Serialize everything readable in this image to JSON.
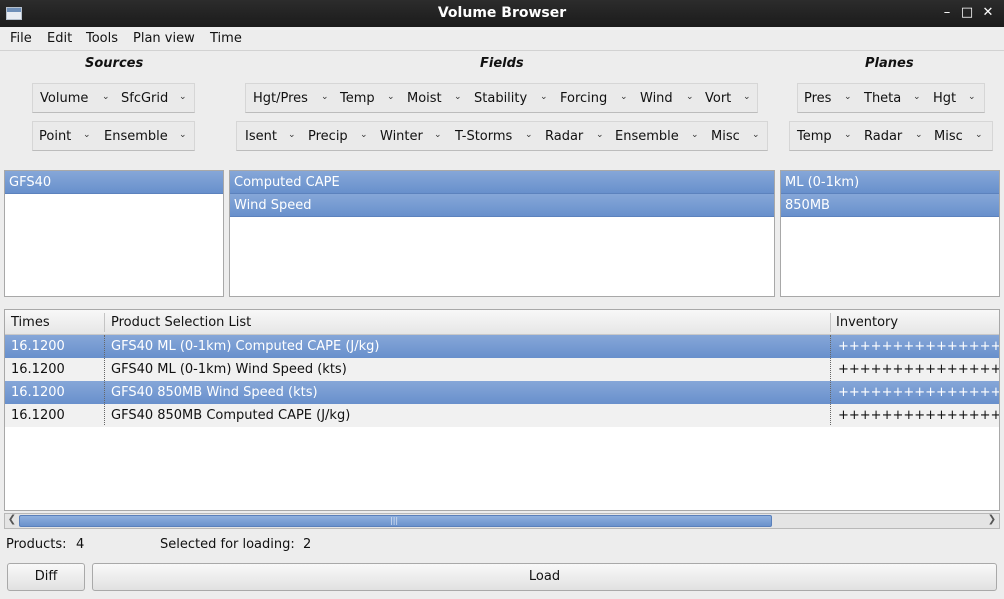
{
  "window": {
    "title": "Volume Browser"
  },
  "menu": [
    "File",
    "Edit",
    "Tools",
    "Plan view",
    "Time"
  ],
  "headers": {
    "sources": "Sources",
    "fields": "Fields",
    "planes": "Planes"
  },
  "sources_buttons": [
    "Volume",
    "SfcGrid",
    "Point",
    "Ensemble"
  ],
  "fields_buttons": [
    "Hgt/Pres",
    "Temp",
    "Moist",
    "Stability",
    "Forcing",
    "Wind",
    "Vort",
    "Isent",
    "Precip",
    "Winter",
    "T-Storms",
    "Radar",
    "Ensemble",
    "Misc"
  ],
  "planes_buttons": [
    "Pres",
    "Theta",
    "Hgt",
    "Temp",
    "Radar",
    "Misc"
  ],
  "sources_list": [
    "GFS40"
  ],
  "fields_list": [
    "Computed CAPE",
    "Wind Speed"
  ],
  "planes_list": [
    "ML (0-1km)",
    "850MB"
  ],
  "table": {
    "columns": [
      "Times",
      "Product Selection List",
      "Inventory"
    ],
    "rows": [
      {
        "time": "16.1200",
        "product": "GFS40 ML (0-1km) Computed CAPE (J/kg)",
        "inventory": "+++++++++++++++++",
        "selected": true
      },
      {
        "time": "16.1200",
        "product": "GFS40 ML (0-1km) Wind Speed (kts)",
        "inventory": "+++++++++++++++++",
        "selected": false
      },
      {
        "time": "16.1200",
        "product": "GFS40 850MB Wind Speed (kts)",
        "inventory": "+++++++++++++++++",
        "selected": true
      },
      {
        "time": "16.1200",
        "product": "GFS40 850MB Computed CAPE (J/kg)",
        "inventory": "+++++++++++++++++",
        "selected": false
      }
    ]
  },
  "status": {
    "products_label": "Products:",
    "products_count": "4",
    "selected_label": "Selected for loading:",
    "selected_count": "2"
  },
  "buttons": {
    "diff": "Diff",
    "load": "Load"
  },
  "icons": {
    "dropdown": "chevron-down-icon",
    "scroll_left": "arrow-left-icon",
    "scroll_right": "arrow-right-icon"
  },
  "colors": {
    "selection": "#7399d2",
    "titlebar": "#222222"
  }
}
